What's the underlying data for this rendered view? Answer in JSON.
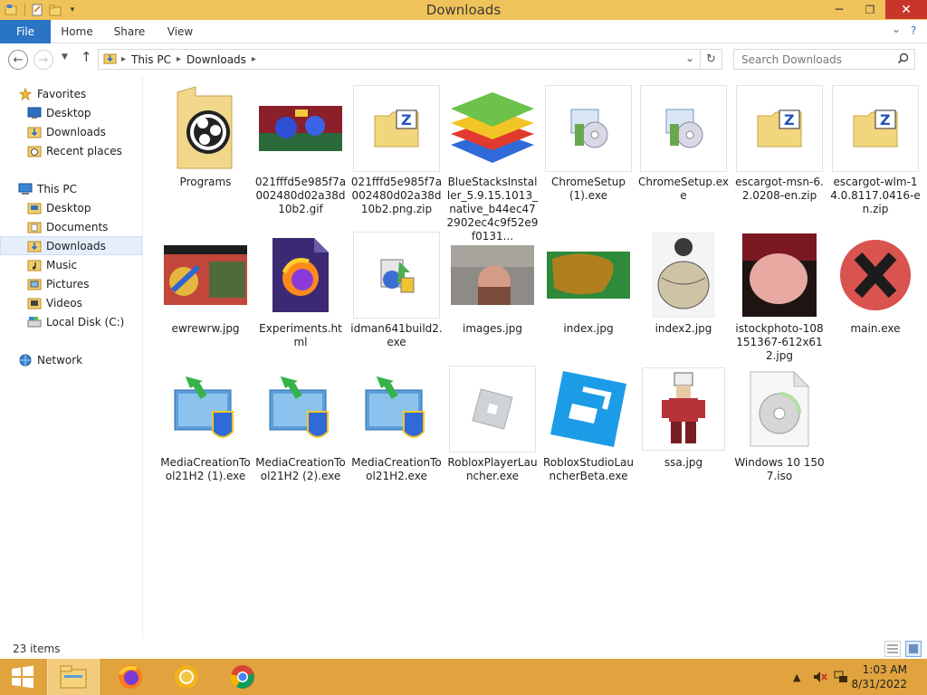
{
  "window": {
    "title": "Downloads",
    "minimize_glyph": "─",
    "maximize_glyph": "❐",
    "close_glyph": "✕"
  },
  "ribbon": {
    "tabs": [
      "File",
      "Home",
      "Share",
      "View"
    ],
    "collapse_glyph": "⌄",
    "help_glyph": "?"
  },
  "address": {
    "path": [
      "This PC",
      "Downloads"
    ],
    "dropdown_glyph": "⌄",
    "refresh_glyph": "↻"
  },
  "search": {
    "placeholder": "Search Downloads"
  },
  "nav": {
    "favorites_label": "Favorites",
    "favorites": [
      "Desktop",
      "Downloads",
      "Recent places"
    ],
    "thispc_label": "This PC",
    "thispc": [
      "Desktop",
      "Documents",
      "Downloads",
      "Music",
      "Pictures",
      "Videos",
      "Local Disk (C:)"
    ],
    "network_label": "Network",
    "selected": "Downloads"
  },
  "files": [
    {
      "name": "Programs",
      "icon": "folder-obs-icon"
    },
    {
      "name": "021fffd5e985f7a002480d02a38d10b2.gif",
      "icon": "image-thumbnail"
    },
    {
      "name": "021fffd5e985f7a002480d02a38d10b2.png.zip",
      "icon": "zip-icon"
    },
    {
      "name": "BlueStacksInstaller_5.9.15.1013_native_b44ec472902ec4c9f52e9f0131...",
      "icon": "bluestacks-icon"
    },
    {
      "name": "ChromeSetup (1).exe",
      "icon": "installer-icon"
    },
    {
      "name": "ChromeSetup.exe",
      "icon": "installer-icon"
    },
    {
      "name": "escargot-msn-6.2.0208-en.zip",
      "icon": "zip-icon"
    },
    {
      "name": "escargot-wlm-14.0.8117.0416-en.zip",
      "icon": "zip-icon"
    },
    {
      "name": "ewrewrw.jpg",
      "icon": "image-thumbnail"
    },
    {
      "name": "Experiments.html",
      "icon": "firefox-doc-icon"
    },
    {
      "name": "idman641build2.exe",
      "icon": "idm-installer-icon"
    },
    {
      "name": "images.jpg",
      "icon": "image-thumbnail"
    },
    {
      "name": "index.jpg",
      "icon": "image-thumbnail"
    },
    {
      "name": "index2.jpg",
      "icon": "image-thumbnail"
    },
    {
      "name": "istockphoto-108151367-612x612.jpg",
      "icon": "image-thumbnail"
    },
    {
      "name": "main.exe",
      "icon": "red-x-icon"
    },
    {
      "name": "MediaCreationTool21H2 (1).exe",
      "icon": "media-creation-icon"
    },
    {
      "name": "MediaCreationTool21H2 (2).exe",
      "icon": "media-creation-icon"
    },
    {
      "name": "MediaCreationTool21H2.exe",
      "icon": "media-creation-icon"
    },
    {
      "name": "RobloxPlayerLauncher.exe",
      "icon": "roblox-player-icon"
    },
    {
      "name": "RobloxStudioLauncherBeta.exe",
      "icon": "roblox-studio-icon"
    },
    {
      "name": "ssa.jpg",
      "icon": "image-thumbnail"
    },
    {
      "name": "Windows 10 1507.iso",
      "icon": "disc-image-icon"
    }
  ],
  "status": {
    "item_count": "23 items"
  },
  "taskbar": {
    "time": "1:03 AM",
    "date": "8/31/2022"
  },
  "colors": {
    "titlebar": "#f0c35a",
    "taskbar": "#e0a33e",
    "file_tab": "#2a74c4",
    "close": "#c7352b",
    "selection": "#e5eefa"
  }
}
